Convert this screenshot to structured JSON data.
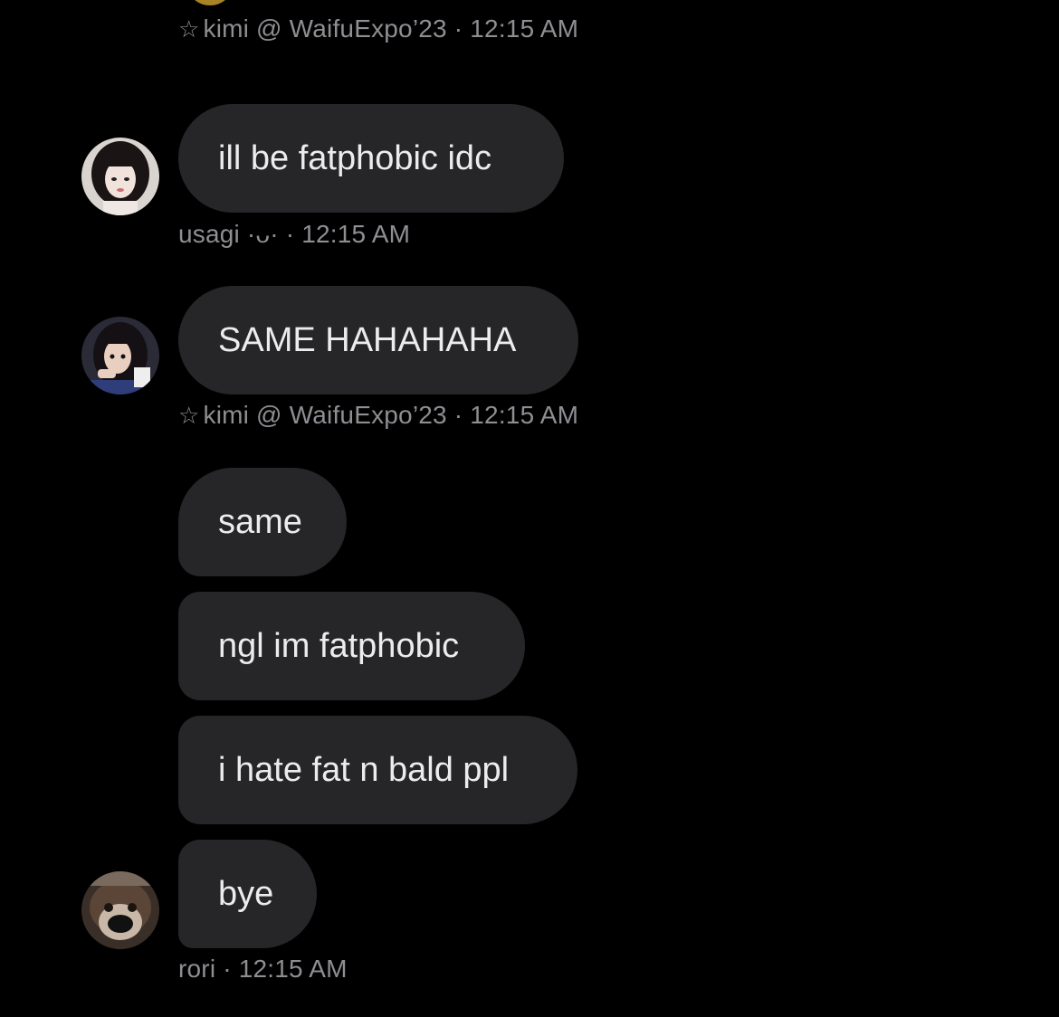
{
  "colors": {
    "background": "#000000",
    "bubble": "#262628",
    "bubble_text": "#ececee",
    "meta_text": "#8e8e93"
  },
  "messages": {
    "m0": {
      "meta_star": "☆",
      "meta_name": "kimi @ WaifuExpo’23",
      "meta_time": "· 12:15 AM"
    },
    "m1": {
      "avatar_icon": "avatar-usagi-icon",
      "text": "ill be fatphobic idc",
      "meta_name": "usagi ·ᴗ·",
      "meta_time": "· 12:15 AM"
    },
    "m2": {
      "avatar_icon": "avatar-kimi-icon",
      "text": "SAME HAHAHAHA",
      "meta_star": "☆",
      "meta_name": "kimi @ WaifuExpo’23",
      "meta_time": "· 12:15 AM"
    },
    "m3": {
      "texts": [
        "same",
        "ngl im fatphobic",
        "i hate fat n bald ppl",
        "bye"
      ],
      "avatar_icon": "avatar-rori-icon",
      "meta_name": "rori",
      "meta_time": "· 12:15 AM"
    }
  }
}
